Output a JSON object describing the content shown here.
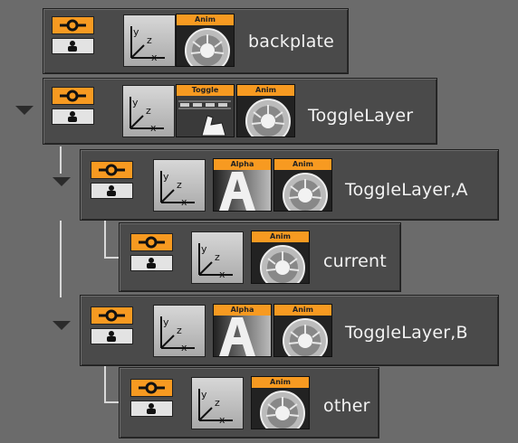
{
  "plugin_labels": {
    "anim": "Anim",
    "toggle": "Toggle",
    "alpha": "Alpha"
  },
  "nodes": [
    {
      "label": "backplate"
    },
    {
      "label": "ToggleLayer"
    },
    {
      "label": "ToggleLayer,A"
    },
    {
      "label": "current"
    },
    {
      "label": "ToggleLayer,B"
    },
    {
      "label": "other"
    }
  ],
  "colors": {
    "accent": "#f79a21",
    "node_bg": "#4a4a4a",
    "background": "#6b6b6b"
  }
}
